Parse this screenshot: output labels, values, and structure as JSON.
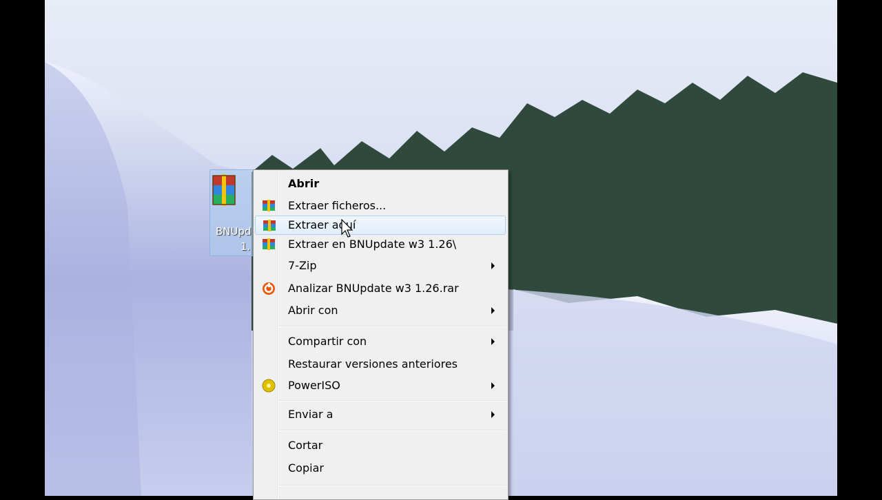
{
  "desktop": {
    "file_label_line1": "BNUpd",
    "file_label_line2": "1."
  },
  "context_menu": {
    "items": [
      {
        "label": "Abrir",
        "icon": null,
        "bold": true
      },
      {
        "label": "Extraer ficheros...",
        "icon": "winrar-icon"
      },
      {
        "label": "Extraer aquí",
        "icon": "winrar-icon",
        "highlighted": true
      },
      {
        "label": "Extraer en BNUpdate w3 1.26\\",
        "icon": "winrar-icon"
      },
      {
        "label": "7-Zip",
        "submenu": true
      },
      {
        "label": "Analizar BNUpdate w3 1.26.rar",
        "icon": "avast-scan-icon"
      },
      {
        "label": "Abrir con",
        "submenu": true
      },
      {
        "label": "Compartir con",
        "submenu": true
      },
      {
        "label": "Restaurar versiones anteriores"
      },
      {
        "label": "PowerISO",
        "icon": "poweriso-icon",
        "submenu": true
      },
      {
        "label": "Enviar a",
        "submenu": true
      },
      {
        "label": "Cortar"
      },
      {
        "label": "Copiar"
      }
    ]
  },
  "colors": {
    "menu_bg": "#f0f0f0",
    "highlight_border": "#aecff7",
    "highlight_bg": "#e2edfb"
  }
}
